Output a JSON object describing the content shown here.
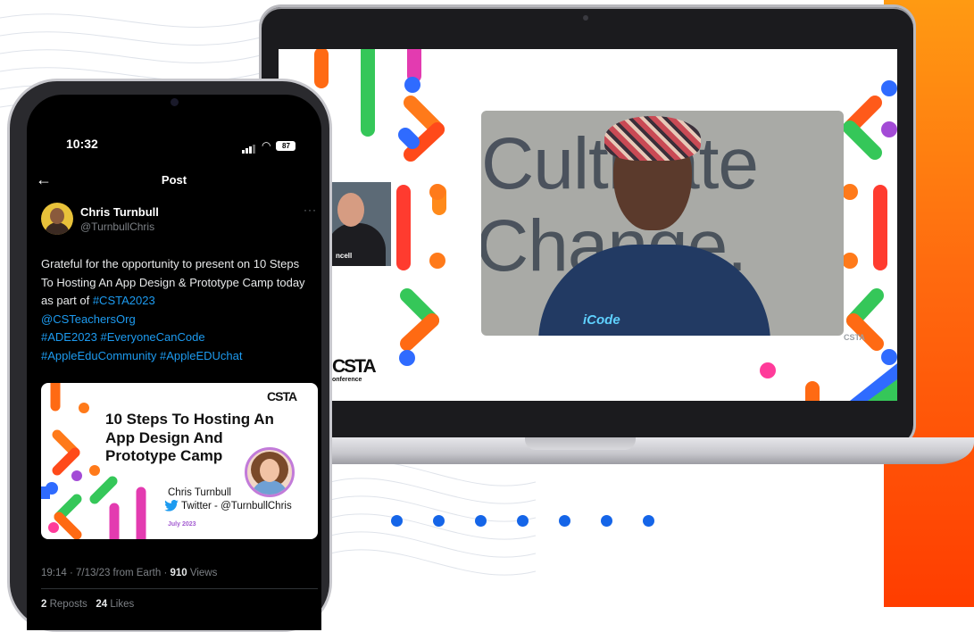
{
  "phone": {
    "status_time": "10:32",
    "battery": "87",
    "header_title": "Post",
    "author_name": "Chris Turnbull",
    "author_handle": "@TurnbullChris",
    "tweet_text": "Grateful for the opportunity to present on 10 Steps To Hosting An App Design & Prototype Camp today as part of",
    "hashtag_csta": "#CSTA2023",
    "mention": "@CSTeachersOrg",
    "hashtag_ade": "#ADE2023",
    "hashtag_ecc": "#EveryoneCanCode",
    "hashtag_aec": "#AppleEduCommunity",
    "hashtag_aedu": "#AppleEDUchat",
    "card": {
      "logo": "CSTA",
      "title": "10 Steps To Hosting An App Design And Prototype Camp",
      "presenter": "Chris Turnbull",
      "twitter": "Twitter - @TurnbullChris",
      "date": "July 2023"
    },
    "meta_time": "19:14 · 7/13/23 from Earth ·",
    "views_count": "910",
    "views_label": "Views",
    "reposts_count": "2",
    "reposts_label": "Reposts",
    "likes_count": "24",
    "likes_label": "Likes"
  },
  "laptop": {
    "video_backdrop_line1": "Cultivate",
    "video_backdrop_line2": "Change.",
    "shirt_logo": "iCode",
    "small_video_name": "ncell",
    "conference_logo": "CSTA",
    "conference_text": "onference",
    "watermark": "CSTA"
  },
  "dots_count": 7,
  "colors": {
    "accent_orange": "#ff6a0f",
    "dot_blue": "#1565e8",
    "link_blue": "#1d9bf0"
  }
}
